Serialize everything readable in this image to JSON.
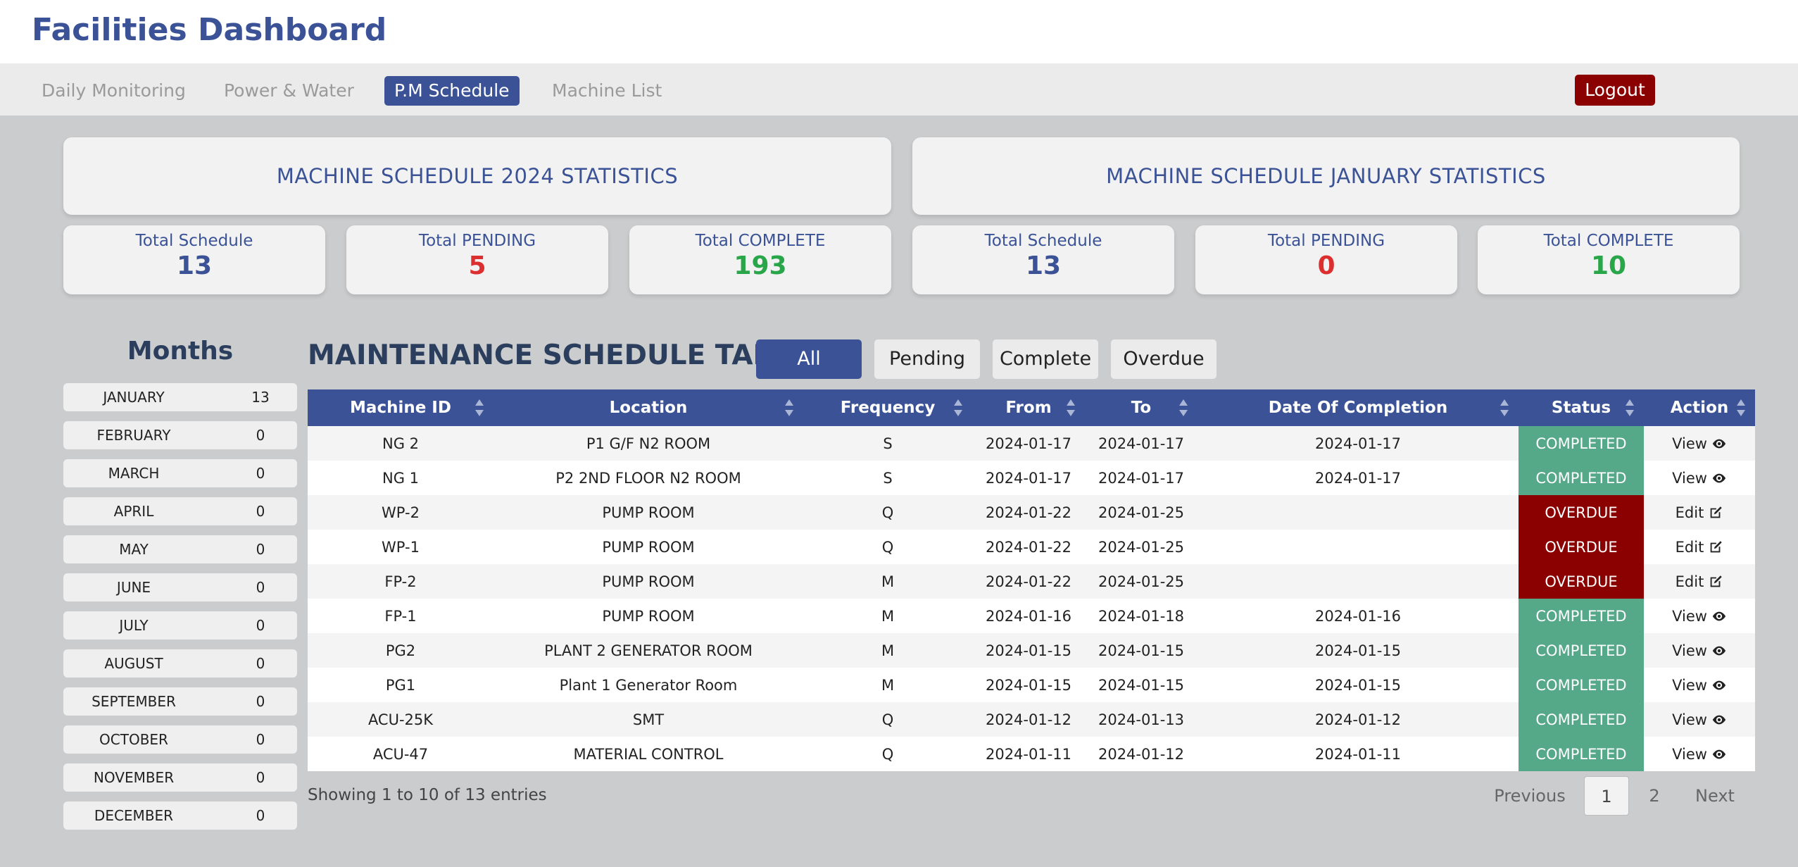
{
  "app": {
    "title": "Facilities Dashboard"
  },
  "nav": {
    "items": [
      {
        "label": "Daily Monitoring"
      },
      {
        "label": "Power & Water"
      },
      {
        "label": "P.M Schedule"
      },
      {
        "label": "Machine List"
      }
    ],
    "active": "P.M Schedule",
    "logout_label": "Logout"
  },
  "yearly_stats": {
    "title": "MACHINE SCHEDULE 2024 STATISTICS",
    "cards": [
      {
        "label": "Total Schedule",
        "value": "13"
      },
      {
        "label": "Total PENDING",
        "value": "5"
      },
      {
        "label": "Total COMPLETE",
        "value": "193"
      }
    ]
  },
  "monthly_stats": {
    "title": "MACHINE SCHEDULE JANUARY STATISTICS",
    "cards": [
      {
        "label": "Total Schedule",
        "value": "13"
      },
      {
        "label": "Total PENDING",
        "value": "0"
      },
      {
        "label": "Total COMPLETE",
        "value": "10"
      }
    ]
  },
  "months": {
    "title": "Months",
    "items": [
      {
        "name": "JANUARY",
        "count": "13"
      },
      {
        "name": "FEBRUARY",
        "count": "0"
      },
      {
        "name": "MARCH",
        "count": "0"
      },
      {
        "name": "APRIL",
        "count": "0"
      },
      {
        "name": "MAY",
        "count": "0"
      },
      {
        "name": "JUNE",
        "count": "0"
      },
      {
        "name": "JULY",
        "count": "0"
      },
      {
        "name": "AUGUST",
        "count": "0"
      },
      {
        "name": "SEPTEMBER",
        "count": "0"
      },
      {
        "name": "OCTOBER",
        "count": "0"
      },
      {
        "name": "NOVEMBER",
        "count": "0"
      },
      {
        "name": "DECEMBER",
        "count": "0"
      }
    ]
  },
  "table": {
    "title": "MAINTENANCE SCHEDULE TABLE",
    "filters": [
      {
        "label": "All"
      },
      {
        "label": "Pending"
      },
      {
        "label": "Complete"
      },
      {
        "label": "Overdue"
      }
    ],
    "active_filter": "All",
    "columns": [
      "Machine ID",
      "Location",
      "Frequency",
      "From",
      "To",
      "Date Of Completion",
      "Status",
      "Action"
    ],
    "rows": [
      {
        "machine_id": "NG 2",
        "location": "P1 G/F N2 ROOM",
        "frequency": "S",
        "from": "2024-01-17",
        "to": "2024-01-17",
        "completion": "2024-01-17",
        "status": "COMPLETED",
        "action": "View"
      },
      {
        "machine_id": "NG 1",
        "location": "P2 2ND FLOOR N2 ROOM",
        "frequency": "S",
        "from": "2024-01-17",
        "to": "2024-01-17",
        "completion": "2024-01-17",
        "status": "COMPLETED",
        "action": "View"
      },
      {
        "machine_id": "WP-2",
        "location": "PUMP ROOM",
        "frequency": "Q",
        "from": "2024-01-22",
        "to": "2024-01-25",
        "completion": "",
        "status": "OVERDUE",
        "action": "Edit"
      },
      {
        "machine_id": "WP-1",
        "location": "PUMP ROOM",
        "frequency": "Q",
        "from": "2024-01-22",
        "to": "2024-01-25",
        "completion": "",
        "status": "OVERDUE",
        "action": "Edit"
      },
      {
        "machine_id": "FP-2",
        "location": "PUMP ROOM",
        "frequency": "M",
        "from": "2024-01-22",
        "to": "2024-01-25",
        "completion": "",
        "status": "OVERDUE",
        "action": "Edit"
      },
      {
        "machine_id": "FP-1",
        "location": "PUMP ROOM",
        "frequency": "M",
        "from": "2024-01-16",
        "to": "2024-01-18",
        "completion": "2024-01-16",
        "status": "COMPLETED",
        "action": "View"
      },
      {
        "machine_id": "PG2",
        "location": "PLANT 2 GENERATOR ROOM",
        "frequency": "M",
        "from": "2024-01-15",
        "to": "2024-01-15",
        "completion": "2024-01-15",
        "status": "COMPLETED",
        "action": "View"
      },
      {
        "machine_id": "PG1",
        "location": "Plant 1 Generator Room",
        "frequency": "M",
        "from": "2024-01-15",
        "to": "2024-01-15",
        "completion": "2024-01-15",
        "status": "COMPLETED",
        "action": "View"
      },
      {
        "machine_id": "ACU-25K",
        "location": "SMT",
        "frequency": "Q",
        "from": "2024-01-12",
        "to": "2024-01-13",
        "completion": "2024-01-12",
        "status": "COMPLETED",
        "action": "View"
      },
      {
        "machine_id": "ACU-47",
        "location": "MATERIAL CONTROL",
        "frequency": "Q",
        "from": "2024-01-11",
        "to": "2024-01-12",
        "completion": "2024-01-11",
        "status": "COMPLETED",
        "action": "View"
      }
    ],
    "entries_info": "Showing 1 to 10 of 13 entries"
  },
  "pagination": {
    "previous": "Previous",
    "pages": [
      "1",
      "2"
    ],
    "current": "1",
    "next": "Next"
  },
  "colors": {
    "brand": "#3b5396",
    "completed": "#55a888",
    "overdue": "#8b0000",
    "logout": "#8b0000"
  }
}
